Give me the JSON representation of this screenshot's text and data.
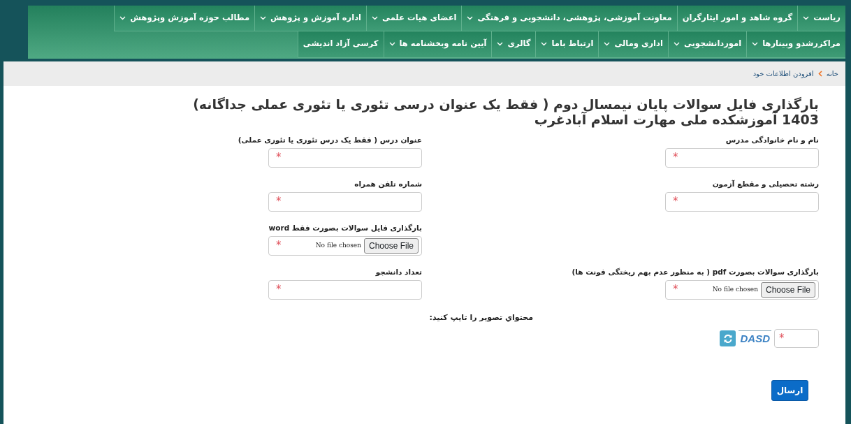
{
  "nav": {
    "items": [
      {
        "label": "ریاست",
        "dropdown": true
      },
      {
        "label": "گروه شاهد و امور ایثارگران",
        "dropdown": false
      },
      {
        "label": "معاونت آموزشی، پژوهشی، دانشجویی و فرهنگی",
        "dropdown": true
      },
      {
        "label": "اعضای هیات علمی",
        "dropdown": true
      },
      {
        "label": "اداره آموزش و پژوهش",
        "dropdown": true
      },
      {
        "label": "مطالب حوزه آموزش وپژوهش",
        "dropdown": true
      },
      {
        "label": "مراکزرشدو وبینارها",
        "dropdown": true
      },
      {
        "label": "اموردانشجویی",
        "dropdown": true
      },
      {
        "label": "اداری ومالی",
        "dropdown": true
      },
      {
        "label": "ارتباط باما",
        "dropdown": true
      },
      {
        "label": "گالری",
        "dropdown": true
      },
      {
        "label": "آیین نامه وبخشنامه ها",
        "dropdown": true
      },
      {
        "label": "کرسی آزاد اندیشی",
        "dropdown": false
      }
    ]
  },
  "breadcrumb": [
    {
      "label": "خانه"
    },
    {
      "label": "افزودن اطلاعات خود"
    }
  ],
  "title": "بارگذاری فایل سوالات پایان نیمسال دوم ( فقط یک عنوان درسی تئوری یا تئوری عملی جداگانه) 1403 آموزشکده ملی مهارت اسلام آبادغرب",
  "form": {
    "rows": [
      {
        "right": {
          "label": "نام و نام خانوادگی مدرس",
          "kind": "text",
          "marker": "*"
        },
        "left": {
          "label": "عنوان درس ( فقط یک درس تئوری یا تئوری عملی)",
          "kind": "text",
          "marker": "*"
        }
      },
      {
        "right": {
          "label": "رشته تحصیلی و مقطع آزمون",
          "kind": "text",
          "marker": "*"
        },
        "left": {
          "label": "شماره تلفن همراه",
          "kind": "text",
          "marker": "*"
        }
      },
      {
        "left": {
          "label": "بارگذاری فایل سوالات بصورت فقط word",
          "kind": "file",
          "marker": "*",
          "file_status": "No file chosen",
          "file_button": "Choose File"
        }
      },
      {
        "right": {
          "label": "بارگذاری سوالات بصورت pdf ( به منظور عدم بهم ریختگی فونت ها)",
          "kind": "file",
          "marker": "*",
          "file_status": "No file chosen",
          "file_button": "Choose File"
        },
        "left": {
          "label": "تعداد دانشجو",
          "kind": "text",
          "marker": "*"
        }
      }
    ],
    "captcha": {
      "label": "محتواي تصوير را تايپ كنيد:",
      "marker": "*",
      "image_text": "DASD"
    },
    "submit": "ارسال"
  }
}
